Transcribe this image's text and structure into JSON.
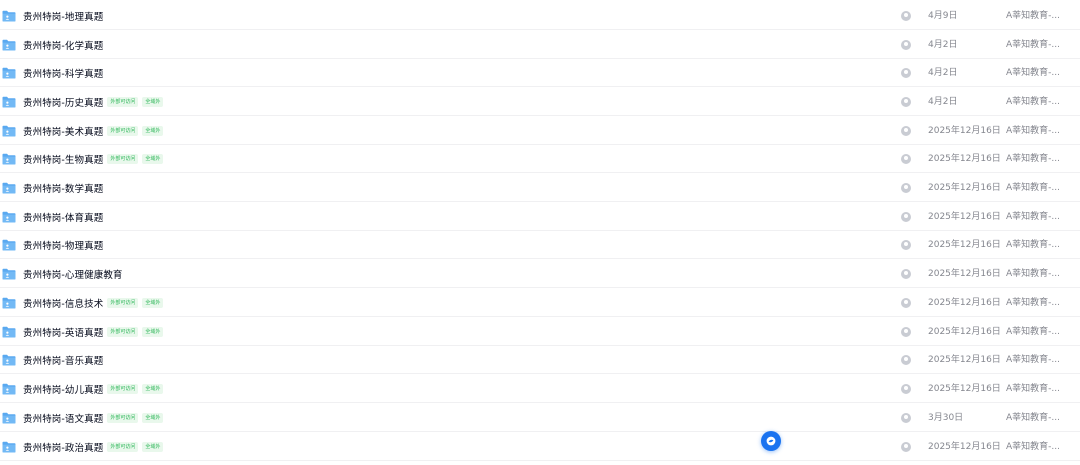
{
  "file_list": {
    "rows": [
      {
        "name": "贵州特岗-地理真题",
        "tags": [],
        "date": "4月9日",
        "source": "A莘知教育-..."
      },
      {
        "name": "贵州特岗-化学真题",
        "tags": [],
        "date": "4月2日",
        "source": "A莘知教育-..."
      },
      {
        "name": "贵州特岗-科学真题",
        "tags": [],
        "date": "4月2日",
        "source": "A莘知教育-..."
      },
      {
        "name": "贵州特岗-历史真题",
        "tags": [
          "外部可访问",
          "全域外"
        ],
        "date": "4月2日",
        "source": "A莘知教育-..."
      },
      {
        "name": "贵州特岗-美术真题",
        "tags": [
          "外部可访问",
          "全域外"
        ],
        "date": "2025年12月16日",
        "source": "A莘知教育-..."
      },
      {
        "name": "贵州特岗-生物真题",
        "tags": [
          "外部可访问",
          "全域外"
        ],
        "date": "2025年12月16日",
        "source": "A莘知教育-..."
      },
      {
        "name": "贵州特岗-数学真题",
        "tags": [],
        "date": "2025年12月16日",
        "source": "A莘知教育-..."
      },
      {
        "name": "贵州特岗-体育真题",
        "tags": [],
        "date": "2025年12月16日",
        "source": "A莘知教育-..."
      },
      {
        "name": "贵州特岗-物理真题",
        "tags": [],
        "date": "2025年12月16日",
        "source": "A莘知教育-..."
      },
      {
        "name": "贵州特岗-心理健康教育",
        "tags": [],
        "date": "2025年12月16日",
        "source": "A莘知教育-..."
      },
      {
        "name": "贵州特岗-信息技术",
        "tags": [
          "外部可访问",
          "全域外"
        ],
        "date": "2025年12月16日",
        "source": "A莘知教育-..."
      },
      {
        "name": "贵州特岗-英语真题",
        "tags": [
          "外部可访问",
          "全域外"
        ],
        "date": "2025年12月16日",
        "source": "A莘知教育-..."
      },
      {
        "name": "贵州特岗-音乐真题",
        "tags": [],
        "date": "2025年12月16日",
        "source": "A莘知教育-..."
      },
      {
        "name": "贵州特岗-幼儿真题",
        "tags": [
          "外部可访问",
          "全域外"
        ],
        "date": "2025年12月16日",
        "source": "A莘知教育-..."
      },
      {
        "name": "贵州特岗-语文真题",
        "tags": [
          "外部可访问",
          "全域外"
        ],
        "date": "3月30日",
        "source": "A莘知教育-..."
      },
      {
        "name": "贵州特岗-政治真题",
        "tags": [
          "外部可访问",
          "全域外"
        ],
        "date": "2025年12月16日",
        "source": "A莘知教育-..."
      }
    ]
  },
  "icons": {
    "folder": "folder-icon",
    "status": "status-icon",
    "floating_action": "floating-action-icon"
  },
  "colors": {
    "folder": "#5aa9f0",
    "tag_bg": "#e9f8ec",
    "tag_text": "#2fb75a",
    "accent": "#1a73f0"
  }
}
